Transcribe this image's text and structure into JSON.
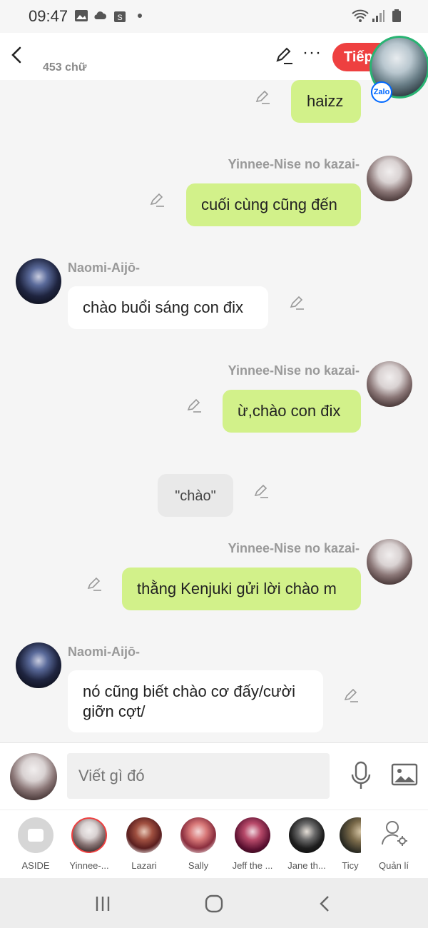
{
  "status": {
    "time": "09:47"
  },
  "header": {
    "word_count": "453 chữ",
    "next_label": "Tiếp",
    "zalo_label": "Zalo"
  },
  "messages": [
    {
      "side": "right",
      "text": "haizz"
    },
    {
      "side": "right",
      "sender": "Yinnee-Nise no kazai-",
      "text": "cuối cùng cũng đến"
    },
    {
      "side": "left",
      "sender": "Naomi-Aijō-",
      "text": "chào buổi sáng con đix"
    },
    {
      "side": "right",
      "sender": "Yinnee-Nise no kazai-",
      "text": "ừ,chào con đix"
    },
    {
      "side": "center",
      "text": "\"chào\""
    },
    {
      "side": "right",
      "sender": "Yinnee-Nise no kazai-",
      "text": "thằng Kenjuki gửi lời chào m"
    },
    {
      "side": "left",
      "sender": "Naomi-Aijō-",
      "text": "nó cũng biết chào cơ đấy/cười giỡn cợt/"
    }
  ],
  "input": {
    "placeholder": "Viết gì đó"
  },
  "characters": [
    {
      "name": "ASIDE"
    },
    {
      "name": "Yinnee-..."
    },
    {
      "name": "Lazari"
    },
    {
      "name": "Sally"
    },
    {
      "name": "Jeff the ..."
    },
    {
      "name": "Jane th..."
    },
    {
      "name": "Ticy"
    },
    {
      "name": "Quản lí"
    }
  ],
  "colors": {
    "accent_red": "#ee4040",
    "bubble_green": "#d2f18a",
    "zalo_blue": "#0068ff"
  }
}
